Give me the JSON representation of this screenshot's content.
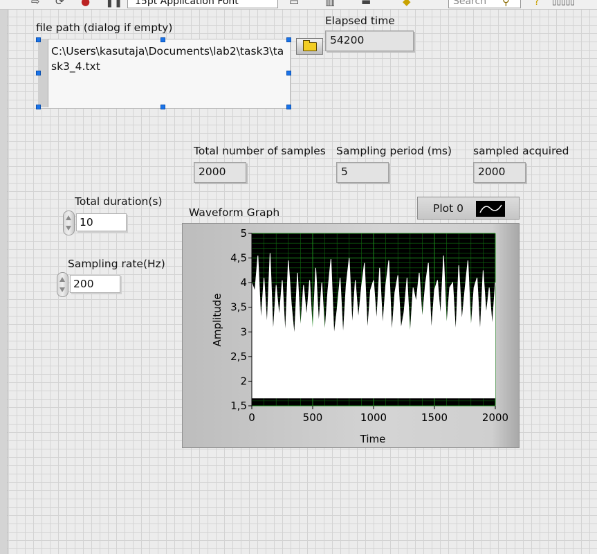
{
  "toolbar": {
    "font_label": "15pt Application Font",
    "search_placeholder": "Search",
    "icons": [
      "run-arrow-icon",
      "run-continuous-icon",
      "abort-icon",
      "pause-icon",
      "align-icon",
      "distribute-icon",
      "resize-icon",
      "reorder-icon",
      "search-icon",
      "help-icon",
      "grid-icon"
    ]
  },
  "file_path": {
    "label": "file path (dialog if empty)",
    "value": "C:\\Users\\kasutaja\\Documents\\lab2\\task3\\task3_4.txt",
    "browse_icon": "folder-icon"
  },
  "elapsed_time": {
    "label": "Elapsed time",
    "value": "54200"
  },
  "total_samples": {
    "label": "Total number of samples",
    "value": "2000"
  },
  "sampling_period": {
    "label": "Sampling period (ms)",
    "value": "5"
  },
  "samples_acquired": {
    "label": "sampled acquired",
    "value": "2000"
  },
  "total_duration": {
    "label": "Total duration(s)",
    "value": "10"
  },
  "sampling_rate": {
    "label": "Sampling rate(Hz)",
    "value": "200"
  },
  "graph": {
    "title": "Waveform Graph",
    "legend_label": "Plot 0",
    "colors": {
      "plot_bg": "#000000",
      "grid": "#0f6b0f",
      "trace": "#ffffff",
      "fill": "#ffffff"
    }
  },
  "chart_data": {
    "type": "line",
    "title": "Waveform Graph",
    "xlabel": "Time",
    "ylabel": "Amplitude",
    "xlim": [
      0,
      2000
    ],
    "ylim": [
      1.5,
      5
    ],
    "xticks": [
      "0",
      "500",
      "1000",
      "1500",
      "2000"
    ],
    "yticks": [
      "1,5",
      "2",
      "2,5",
      "3",
      "3,5",
      "4",
      "4,5",
      "5"
    ],
    "series": [
      {
        "name": "Plot 0",
        "x": [
          0,
          25,
          50,
          75,
          100,
          125,
          150,
          175,
          200,
          225,
          250,
          275,
          300,
          325,
          350,
          375,
          400,
          425,
          450,
          475,
          500,
          525,
          550,
          575,
          600,
          625,
          650,
          675,
          700,
          725,
          750,
          775,
          800,
          825,
          850,
          875,
          900,
          925,
          950,
          975,
          1000,
          1025,
          1050,
          1075,
          1100,
          1125,
          1150,
          1175,
          1200,
          1225,
          1250,
          1275,
          1300,
          1325,
          1350,
          1375,
          1400,
          1425,
          1450,
          1475,
          1500,
          1525,
          1550,
          1575,
          1600,
          1625,
          1650,
          1675,
          1700,
          1725,
          1750,
          1775,
          1800,
          1825,
          1850,
          1875,
          1900,
          1925,
          1950,
          1975,
          2000
        ],
        "values": [
          4.0,
          3.82,
          4.55,
          3.2,
          4.1,
          3.1,
          4.6,
          2.95,
          3.95,
          3.3,
          4.05,
          2.92,
          4.45,
          3.55,
          2.9,
          4.2,
          3.05,
          3.95,
          3.3,
          4.05,
          2.95,
          4.3,
          3.15,
          4.0,
          2.97,
          3.85,
          4.48,
          2.92,
          3.45,
          4.1,
          2.9,
          3.95,
          4.5,
          3.1,
          4.05,
          3.25,
          3.9,
          4.4,
          3.0,
          3.85,
          4.05,
          3.2,
          4.3,
          3.1,
          3.95,
          4.45,
          2.95,
          3.8,
          4.15,
          3.05,
          3.4,
          4.1,
          2.92,
          3.9,
          3.6,
          4.2,
          3.25,
          3.95,
          4.4,
          3.0,
          3.85,
          4.05,
          3.3,
          4.55,
          3.1,
          3.9,
          4.0,
          2.95,
          4.35,
          3.2,
          3.85,
          4.45,
          3.05,
          3.9,
          4.1,
          2.95,
          4.25,
          3.35,
          3.9,
          3.1,
          4.0
        ]
      }
    ]
  }
}
